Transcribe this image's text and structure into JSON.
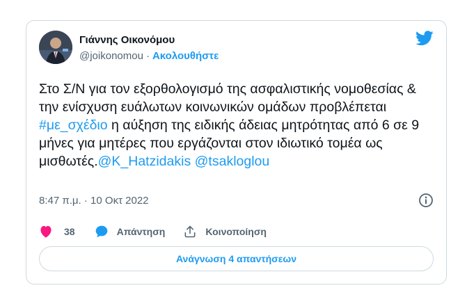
{
  "author": {
    "name": "Γιάννης Οικονόμου",
    "handle": "@joikonomou",
    "separator": "·",
    "follow_label": "Ακολουθήστε"
  },
  "tweet": {
    "text_before_hashtag": "Στο Σ/Ν για τον εξορθολογισμό της ασφαλιστικής νομοθεσίας & την ενίσχυση ευάλωτων κοινωνικών ομάδων προβλέπεται ",
    "hashtag": "#με_σχέδιο",
    "text_after_hashtag": " η αύξηση της ειδικής άδειας μητρότητας από 6 σε 9 μήνες για μητέρες που εργάζονται στον ιδιωτικό τομέα ως μισθωτές.",
    "mention_1": "@K_Hatzidakis",
    "mention_2": "@tsakloglou"
  },
  "meta": {
    "time": "8:47 π.μ.",
    "separator": "·",
    "date": "10 Οκτ 2022"
  },
  "actions": {
    "like_count": "38",
    "reply_label": "Απάντηση",
    "share_label": "Κοινοποίηση"
  },
  "read_replies_label": "Ανάγνωση 4 απαντήσεων",
  "icons": {
    "brand": "twitter-bird-icon",
    "info": "info-icon",
    "like": "heart-icon",
    "reply": "speech-bubble-icon",
    "share": "share-upload-icon"
  },
  "colors": {
    "accent": "#1d9bf0",
    "like": "#f91880",
    "text": "#0f1419",
    "secondary_text": "#536471",
    "border": "#cfd9de"
  }
}
